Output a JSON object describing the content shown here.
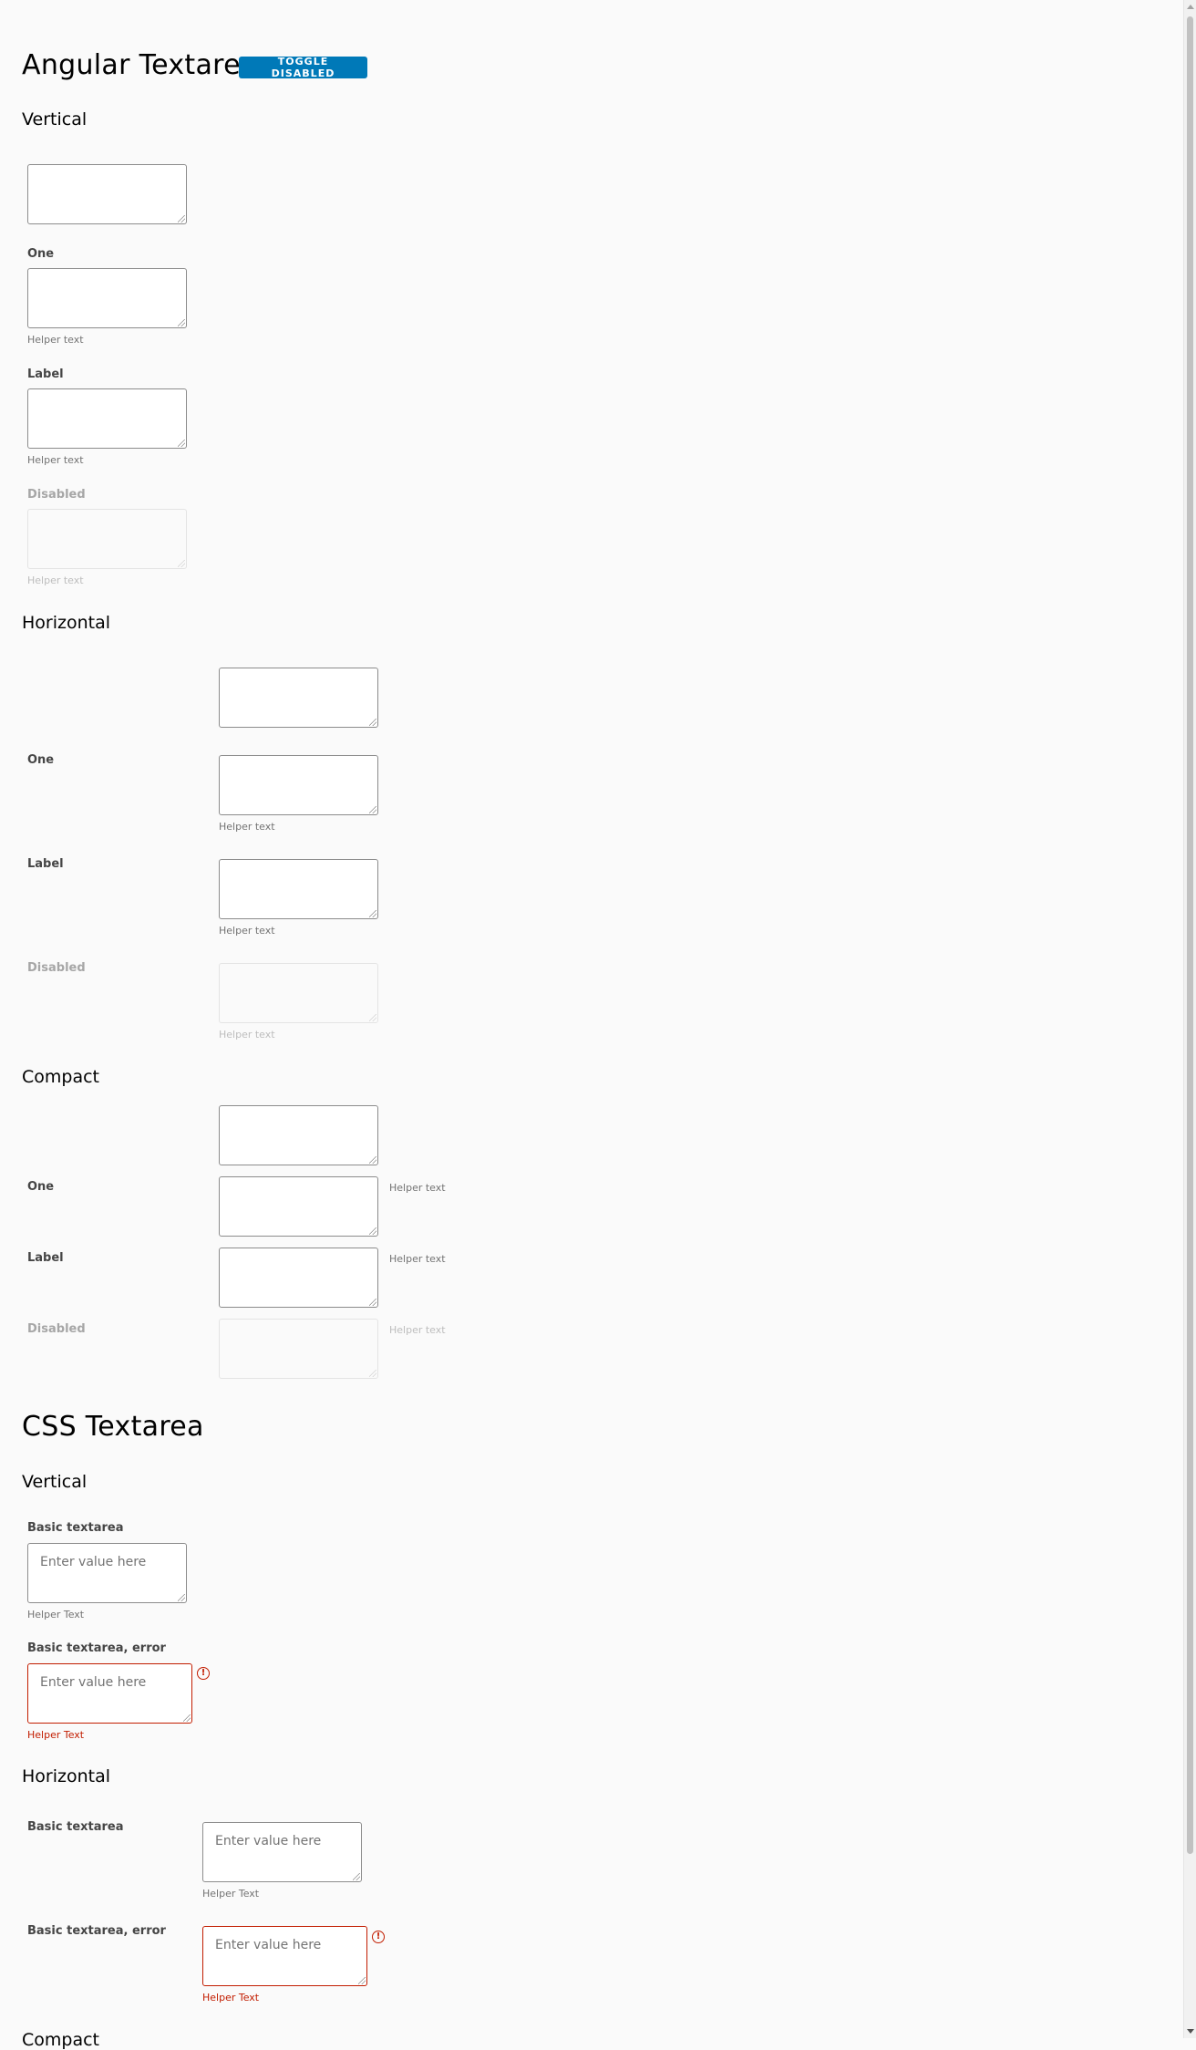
{
  "angular": {
    "title": "Angular Textarea",
    "toggle_button": "TOGGLE DISABLED",
    "vertical": {
      "heading": "Vertical",
      "one_label": "One",
      "one_helper": "Helper text",
      "label_label": "Label",
      "label_helper": "Helper text",
      "disabled_label": "Disabled",
      "disabled_helper": "Helper text"
    },
    "horizontal": {
      "heading": "Horizontal",
      "one_label": "One",
      "one_helper": "Helper text",
      "label_label": "Label",
      "label_helper": "Helper text",
      "disabled_label": "Disabled",
      "disabled_helper": "Helper text"
    },
    "compact": {
      "heading": "Compact",
      "one_label": "One",
      "one_helper": "Helper text",
      "label_label": "Label",
      "label_helper": "Helper text",
      "disabled_label": "Disabled",
      "disabled_helper": "Helper text"
    }
  },
  "css": {
    "title": "CSS Textarea",
    "vertical": {
      "heading": "Vertical",
      "basic_label": "Basic textarea",
      "basic_placeholder": "Enter value here",
      "basic_helper": "Helper Text",
      "error_label": "Basic textarea, error",
      "error_placeholder": "Enter value here",
      "error_helper": "Helper Text"
    },
    "horizontal": {
      "heading": "Horizontal",
      "basic_label": "Basic textarea",
      "basic_placeholder": "Enter value here",
      "basic_helper": "Helper Text",
      "error_label": "Basic textarea, error",
      "error_placeholder": "Enter value here",
      "error_helper": "Helper Text"
    },
    "compact_heading": "Compact"
  },
  "colors": {
    "primary": "#0079b8",
    "error": "#c21d00",
    "background": "#fafafa"
  },
  "icons": {
    "error": "exclamation-circle-icon"
  }
}
